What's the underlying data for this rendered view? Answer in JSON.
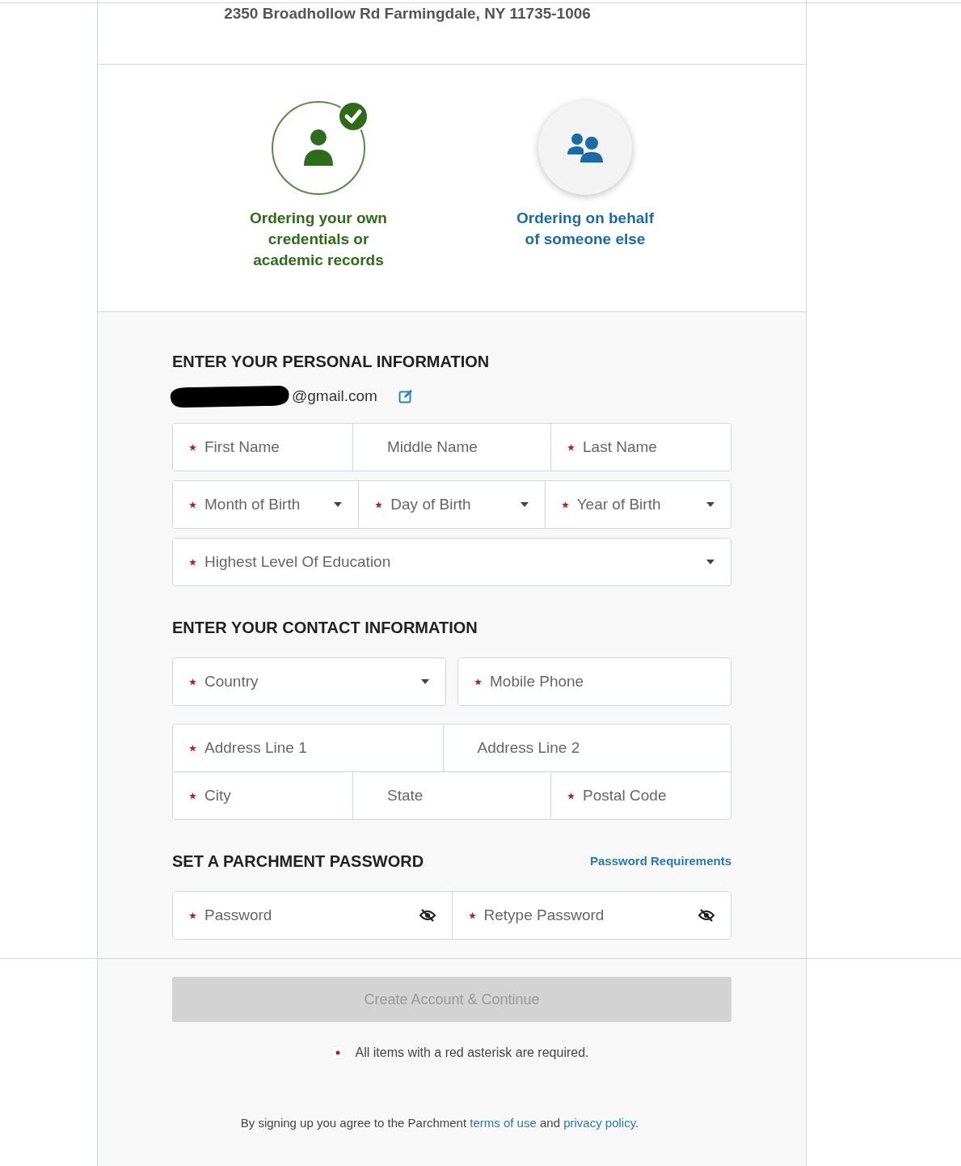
{
  "address": "2350 Broadhollow Rd Farmingdale, NY 11735-1006",
  "order_options": [
    {
      "label": "Ordering your own credentials or academic records",
      "kind": "single",
      "selected": true
    },
    {
      "label": "Ordering on behalf of someone else",
      "kind": "group",
      "selected": false
    }
  ],
  "personal": {
    "heading": "ENTER YOUR PERSONAL INFORMATION",
    "email": "@gmail.com",
    "email_redacted": true,
    "rows": [
      [
        {
          "placeholder": "First Name",
          "required": true,
          "kind": "text"
        },
        {
          "placeholder": "Middle Name",
          "required": false,
          "kind": "text"
        },
        {
          "placeholder": "Last Name",
          "required": true,
          "kind": "text"
        }
      ],
      [
        {
          "placeholder": "Month of Birth",
          "required": true,
          "kind": "select"
        },
        {
          "placeholder": "Day of Birth",
          "required": true,
          "kind": "select"
        },
        {
          "placeholder": "Year of Birth",
          "required": true,
          "kind": "select"
        }
      ],
      [
        {
          "placeholder": "Highest Level Of Education",
          "required": true,
          "kind": "select"
        }
      ]
    ]
  },
  "contact": {
    "heading": "ENTER YOUR CONTACT INFORMATION",
    "groups": [
      [
        [
          {
            "placeholder": "Country",
            "required": true,
            "kind": "select"
          }
        ],
        [
          {
            "placeholder": "Mobile Phone",
            "required": true,
            "kind": "text"
          }
        ]
      ],
      [
        [
          {
            "placeholder": "Address Line 1",
            "required": true,
            "kind": "text"
          },
          {
            "placeholder": "Address Line 2",
            "required": false,
            "kind": "text"
          }
        ],
        [
          {
            "placeholder": "City",
            "required": true,
            "kind": "text"
          },
          {
            "placeholder": "State",
            "required": false,
            "kind": "text"
          },
          {
            "placeholder": "Postal Code",
            "required": true,
            "kind": "text"
          }
        ]
      ]
    ]
  },
  "password": {
    "heading": "SET A PARCHMENT PASSWORD",
    "requirements_link": "Password Requirements",
    "fields": [
      {
        "placeholder": "Password",
        "required": true,
        "kind": "password"
      },
      {
        "placeholder": "Retype Password",
        "required": true,
        "kind": "password"
      }
    ]
  },
  "submit": {
    "label": "Create Account & Continue",
    "disabled": true
  },
  "required_note": "All items with a red asterisk are required.",
  "legal": [
    {
      "kind": "text",
      "text": "By signing up you agree to the Parchment"
    },
    {
      "kind": "link",
      "text": "terms of use"
    },
    {
      "kind": "text",
      "text": "and"
    },
    {
      "kind": "link",
      "text": "privacy policy"
    },
    {
      "kind": "text",
      "text": "."
    }
  ]
}
